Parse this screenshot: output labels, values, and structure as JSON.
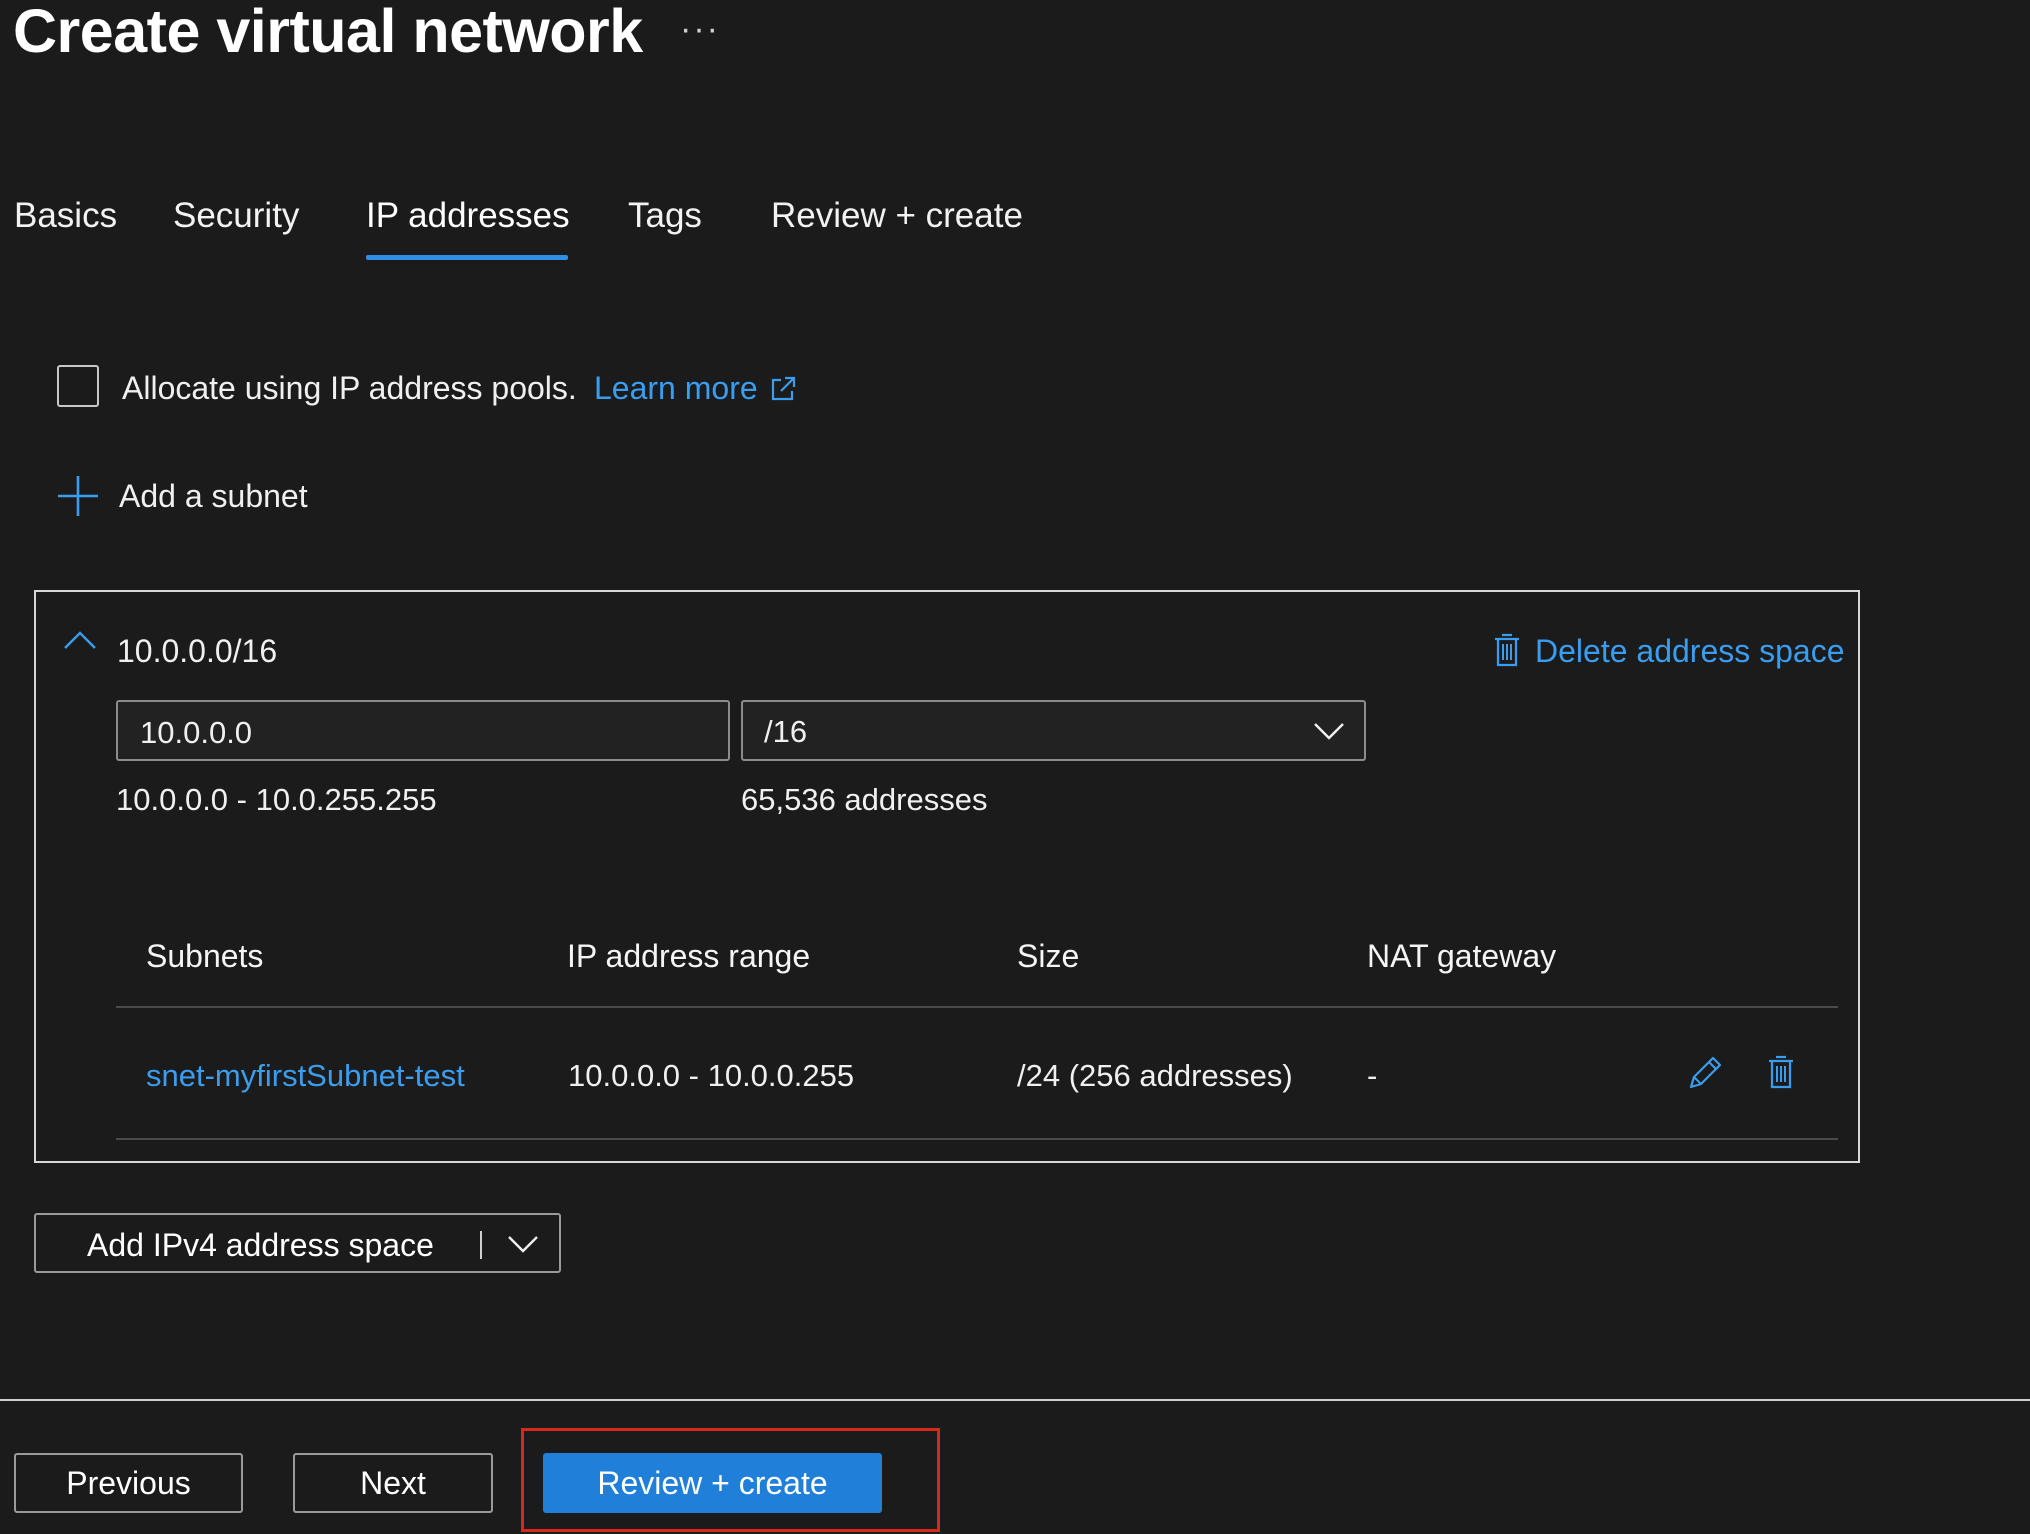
{
  "header": {
    "title": "Create virtual network",
    "more_label": "···"
  },
  "tabs": [
    {
      "label": "Basics"
    },
    {
      "label": "Security"
    },
    {
      "label": "IP addresses",
      "active": true
    },
    {
      "label": "Tags"
    },
    {
      "label": "Review + create"
    }
  ],
  "pools": {
    "checkbox_label": "Allocate using IP address pools.",
    "checked": false,
    "learn_more": "Learn more"
  },
  "add_subnet_label": "Add a subnet",
  "address_space": {
    "title": "10.0.0.0/16",
    "delete_label": "Delete address space",
    "address_value": "10.0.0.0",
    "cidr_value": "/16",
    "range": "10.0.0.0 - 10.0.255.255",
    "count": "65,536 addresses",
    "subnet_table": {
      "columns": [
        "Subnets",
        "IP address range",
        "Size",
        "NAT gateway"
      ],
      "rows": [
        {
          "name": "snet-myfirstSubnet-test",
          "range": "10.0.0.0 - 10.0.0.255",
          "size": "/24 (256 addresses)",
          "nat": "-"
        }
      ]
    }
  },
  "add_space_button": "Add IPv4 address space",
  "footer": {
    "previous": "Previous",
    "next": "Next",
    "review_create": "Review + create"
  },
  "colors": {
    "accent": "#1f7fd9",
    "link": "#3a9df0",
    "highlight": "#d6281b",
    "background": "#1b1b1b"
  },
  "icons": [
    "more-icon",
    "external-link-icon",
    "plus-icon",
    "chevron-up-icon",
    "trash-icon",
    "chevron-down-icon",
    "pencil-icon"
  ]
}
